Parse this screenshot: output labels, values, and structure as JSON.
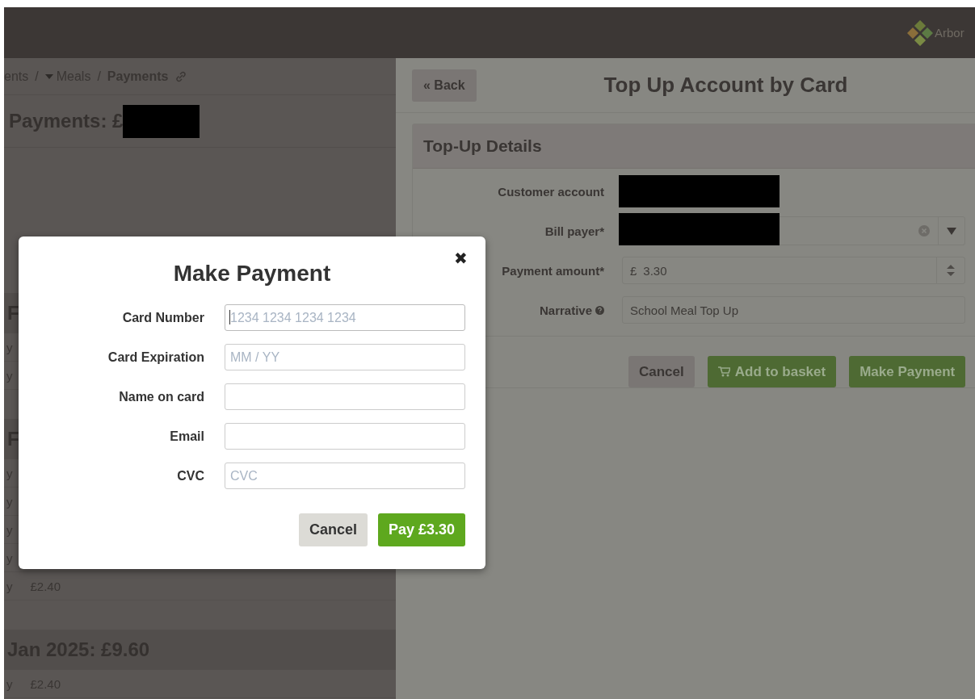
{
  "header": {
    "brand": "Arbor"
  },
  "left_panel": {
    "breadcrumb": [
      {
        "kind": "link",
        "label": "ents",
        "caret": false
      },
      {
        "kind": "separator",
        "label": "/"
      },
      {
        "kind": "link",
        "label": "Meals",
        "caret": true
      },
      {
        "kind": "separator",
        "label": "/"
      },
      {
        "kind": "current",
        "label": "Payments"
      }
    ],
    "heading": {
      "text": "Payments: £",
      "redacted": true
    },
    "sections": [
      {
        "title": "F",
        "rows": [
          {
            "label": "y"
          },
          {
            "label": "y"
          }
        ]
      },
      {
        "title": "F",
        "rows": [
          {
            "label": "y"
          },
          {
            "label": "y"
          },
          {
            "label": "y"
          },
          {
            "label": "y"
          },
          {
            "label": "y",
            "amount": "£2.40"
          }
        ]
      },
      {
        "title": "Jan 2025: £9.60",
        "rows": [
          {
            "label": "y",
            "amount": "£2.40"
          }
        ]
      }
    ]
  },
  "right_panel": {
    "back_button": "« Back",
    "title": "Top Up Account by Card",
    "card": {
      "title": "Top-Up Details",
      "fields": [
        {
          "kind": "redacted",
          "label": "Customer account",
          "help": false
        },
        {
          "kind": "select",
          "label": "Bill payer*",
          "help": false,
          "redacted": true
        },
        {
          "kind": "currency",
          "label": "Payment amount*",
          "help": false,
          "prefix": "£",
          "value": "3.30"
        },
        {
          "kind": "text",
          "label": "Narrative",
          "help": true,
          "value": "School Meal Top Up"
        }
      ],
      "buttons": [
        {
          "kind": "secondary",
          "label": "Cancel",
          "icon": false
        },
        {
          "kind": "primary",
          "label": "Add to basket",
          "icon": true
        },
        {
          "kind": "primary",
          "label": "Make Payment",
          "icon": false
        }
      ]
    }
  },
  "modal": {
    "title": "Make Payment",
    "close": "✖",
    "fields": [
      {
        "label": "Card Number",
        "placeholder": "1234 1234 1234 1234",
        "focused": true
      },
      {
        "label": "Card Expiration",
        "placeholder": "MM / YY",
        "focused": false
      },
      {
        "label": "Name on card",
        "focused": false
      },
      {
        "label": "Email",
        "focused": false
      },
      {
        "label": "CVC",
        "placeholder": "CVC",
        "focused": false
      }
    ],
    "buttons": [
      {
        "kind": "secondary",
        "label": "Cancel"
      },
      {
        "kind": "primary",
        "label": "Pay £3.30"
      }
    ]
  }
}
